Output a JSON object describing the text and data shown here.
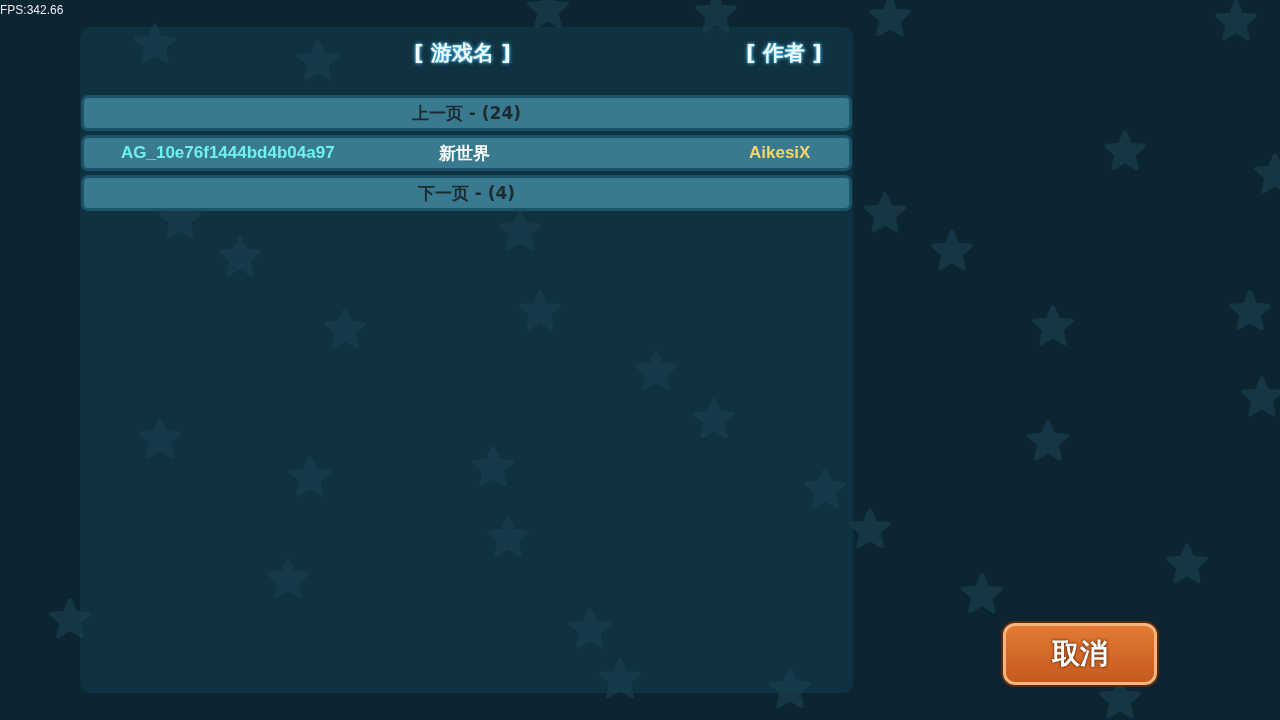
{
  "fps": "FPS:342.66",
  "headers": {
    "name": "[ 游戏名 ]",
    "author": "[ 作者 ]"
  },
  "rows": [
    {
      "kind": "pager",
      "label": "上一页 - (24)"
    },
    {
      "kind": "game",
      "id": "AG_10e76f1444bd4b04a97",
      "name": "新世界",
      "author": "AikesiX"
    },
    {
      "kind": "pager",
      "label": "下一页 - (4)"
    }
  ],
  "cancel_button": "取消"
}
